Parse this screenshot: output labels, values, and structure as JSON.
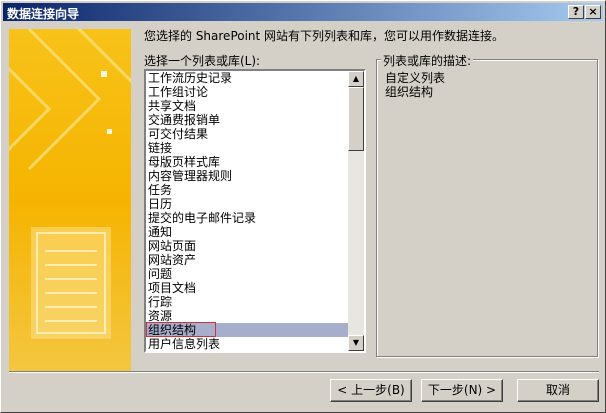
{
  "window": {
    "title": "数据连接向导"
  },
  "intro": "您选择的 SharePoint 网站有下列列表和库，您可以用作数据连接。",
  "list": {
    "label": "选择一个列表或库(L):",
    "items": [
      "工作流历史记录",
      "工作组讨论",
      "共享文档",
      "交通费报销单",
      "可交付结果",
      "链接",
      "母版页样式库",
      "内容管理器规则",
      "任务",
      "日历",
      "提交的电子邮件记录",
      "通知",
      "网站页面",
      "网站资产",
      "问题",
      "项目文档",
      "行踪",
      "资源",
      "组织结构",
      "用户信息列表"
    ],
    "selected_index": 18
  },
  "description": {
    "label": "列表或库的描述:",
    "lines": [
      "自定义列表",
      "组织结构"
    ]
  },
  "buttons": {
    "back": "< 上一步(B)",
    "next": "下一步(N) >",
    "cancel": "取消"
  },
  "icons": {
    "help": "?",
    "close": "×"
  },
  "colors": {
    "titlebar": "#0a246a",
    "selection": "#a6aecb",
    "selection_outline": "#d0323a",
    "banner": "#f5c000"
  }
}
